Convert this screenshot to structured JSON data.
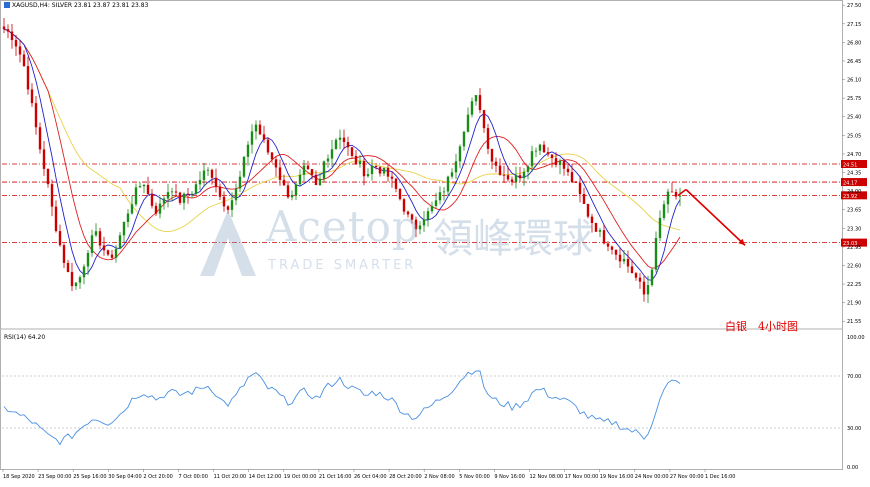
{
  "header": {
    "symbol": "XAGUSD,H4: SILVER 23.81 23.87 23.81 23.83"
  },
  "rsi_label": "RSI(14) 64.20",
  "note": "白银　4小时图",
  "watermark": {
    "en": "Acetop",
    "cn": "領峰環球",
    "tagline": "TRADE SMARTER"
  },
  "colors": {
    "bull": "#1a8c1a",
    "bear": "#cc0000",
    "ma_fast": "#2222cc",
    "ma_mid": "#dd2222",
    "ma_slow": "#e8d24a",
    "rsi": "#4a90e2",
    "level": "#cc0000",
    "arrow": "#e00000"
  },
  "chart_data": [
    {
      "type": "candlestick",
      "title": "",
      "ylim": [
        21.46,
        27.56
      ],
      "y_ticks": [
        "27.50",
        "27.15",
        "26.80",
        "26.45",
        "26.10",
        "25.75",
        "25.40",
        "25.05",
        "24.70",
        "24.35",
        "24.00",
        "23.65",
        "23.30",
        "22.95",
        "22.60",
        "22.25",
        "21.90",
        "21.55"
      ],
      "price_labels": [
        "24.51",
        "24.17",
        "23.92",
        "23.03"
      ],
      "levels": [
        24.51,
        24.17,
        23.92,
        23.03
      ],
      "x_ticks": [
        "18 Sep 2020",
        "23 Sep 00:00",
        "25 Sep 16:00",
        "30 Sep 04:00",
        "2 Oct 20:00",
        "7 Oct 00:00",
        "11 Oct 20:00",
        "14 Oct 12:00",
        "19 Oct 00:00",
        "21 Oct 16:00",
        "26 Oct 04:00",
        "28 Oct 20:00",
        "2 Nov 08:00",
        "5 Nov 00:00",
        "9 Nov 16:00",
        "12 Nov 08:00",
        "17 Nov 00:00",
        "19 Nov 16:00",
        "24 Nov 00:00",
        "27 Nov 00:00",
        "1 Dec 16:00"
      ],
      "close_path": [
        27.05,
        26.95,
        26.7,
        26.3,
        25.6,
        24.9,
        24.3,
        23.6,
        23.0,
        22.5,
        22.2,
        22.4,
        22.9,
        23.2,
        23.0,
        22.7,
        22.9,
        23.3,
        23.7,
        24.0,
        24.2,
        23.8,
        23.6,
        23.9,
        24.1,
        23.8,
        23.9,
        24.0,
        24.2,
        24.4,
        24.3,
        23.9,
        23.7,
        23.9,
        24.3,
        24.9,
        25.3,
        25.0,
        24.7,
        24.5,
        24.1,
        23.9,
        24.1,
        24.4,
        24.3,
        24.0,
        24.6,
        24.8,
        25.1,
        24.9,
        24.6,
        24.5,
        24.3,
        24.5,
        24.4,
        24.3,
        24.1,
        23.8,
        23.5,
        23.3,
        23.5,
        23.6,
        23.8,
        24.0,
        24.3,
        24.7,
        25.2,
        25.6,
        25.8,
        25.1,
        24.6,
        24.4,
        24.3,
        24.2,
        24.3,
        24.5,
        24.8,
        24.9,
        24.7,
        24.6,
        24.5,
        24.3,
        24.1,
        23.8,
        23.5,
        23.3,
        23.1,
        23.0,
        22.8,
        22.7,
        22.5,
        22.3,
        22.0,
        22.6,
        23.4,
        23.9,
        23.96,
        23.83
      ],
      "rsi_ylim": [
        0,
        100
      ],
      "rsi_ticks": [
        "100.00",
        "70.00",
        "30.00",
        "0.00"
      ],
      "rsi_levels": [
        70,
        30
      ],
      "rsi_path": [
        45,
        44,
        40,
        38,
        35,
        30,
        25,
        22,
        20,
        22,
        25,
        30,
        35,
        38,
        36,
        34,
        38,
        42,
        50,
        55,
        58,
        55,
        52,
        56,
        58,
        55,
        57,
        58,
        60,
        63,
        60,
        52,
        48,
        52,
        60,
        68,
        72,
        66,
        60,
        58,
        52,
        50,
        54,
        58,
        56,
        52,
        60,
        64,
        68,
        64,
        60,
        58,
        54,
        58,
        56,
        54,
        50,
        44,
        40,
        38,
        42,
        46,
        50,
        54,
        58,
        64,
        70,
        74,
        76,
        60,
        52,
        50,
        48,
        46,
        48,
        52,
        58,
        60,
        56,
        54,
        52,
        50,
        46,
        42,
        38,
        36,
        34,
        35,
        33,
        30,
        28,
        26,
        22,
        35,
        50,
        62,
        66,
        64.2
      ]
    }
  ]
}
